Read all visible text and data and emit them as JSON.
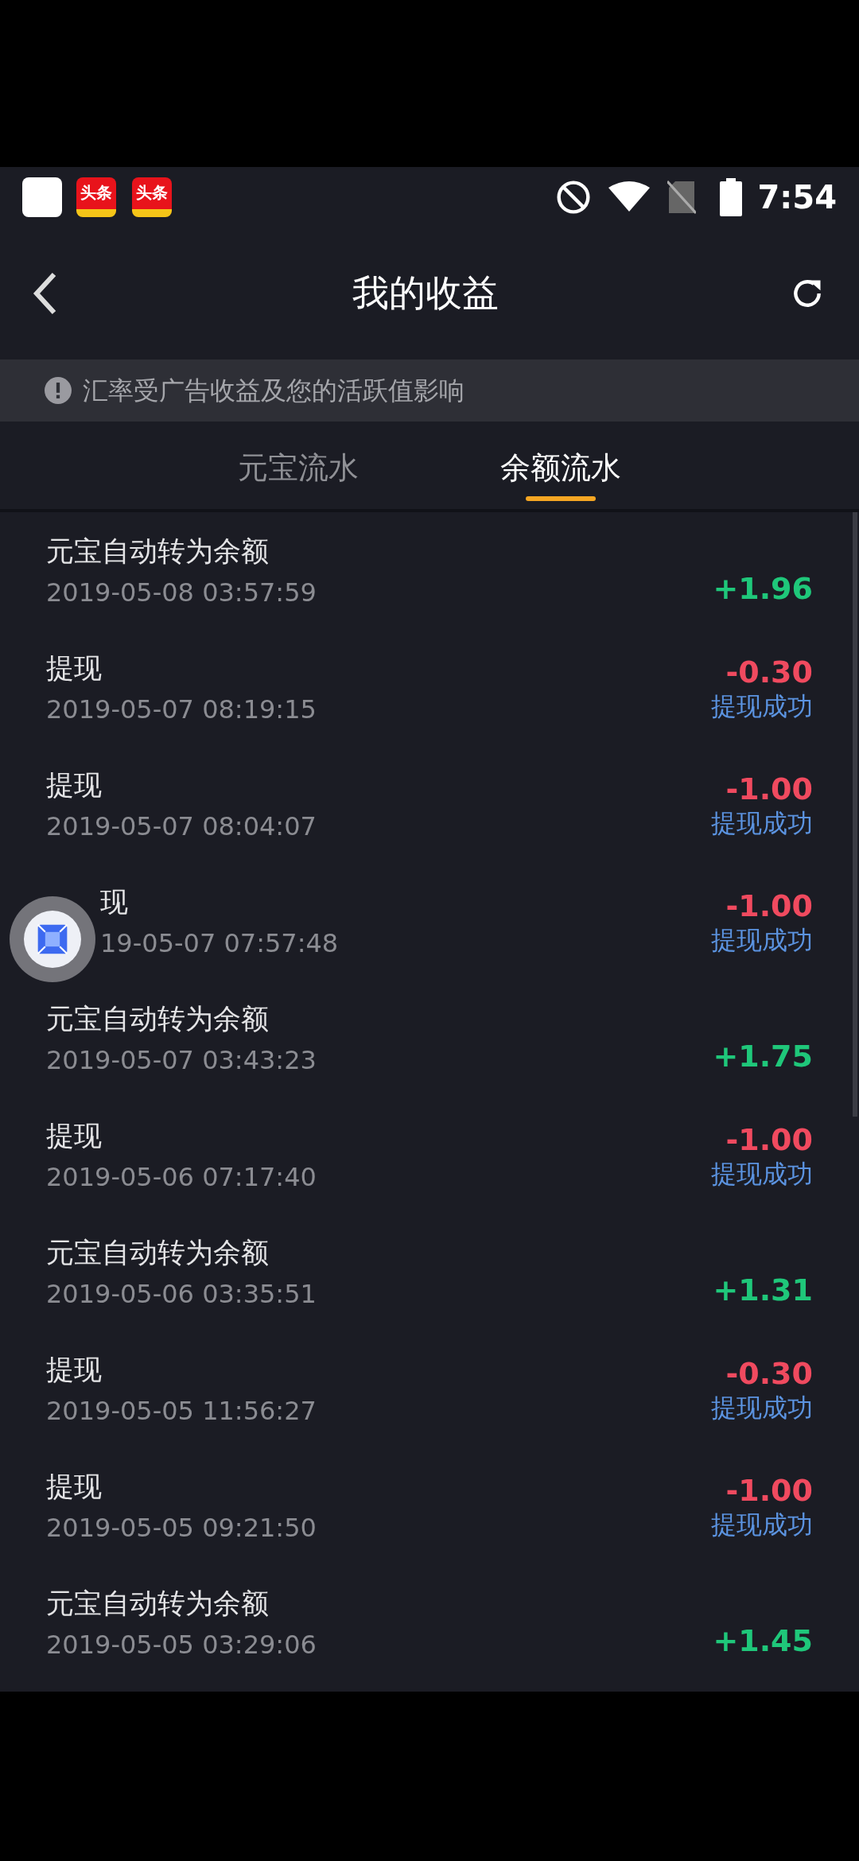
{
  "status_bar": {
    "apps": [
      "头条",
      "头条"
    ],
    "time": "7:54"
  },
  "header": {
    "title": "我的收益"
  },
  "notice": "汇率受广告收益及您的活跃值影响",
  "tabs": [
    {
      "label": "元宝流水",
      "selected": false
    },
    {
      "label": "余额流水",
      "selected": true
    }
  ],
  "records": [
    {
      "kind": "income",
      "title": "元宝自动转为余额",
      "time": "2019-05-08 03:57:59",
      "amount": "+1.96"
    },
    {
      "kind": "withdrawal",
      "title": "提现",
      "time": "2019-05-07 08:19:15",
      "amount": "-0.30",
      "status": "提现成功"
    },
    {
      "kind": "withdrawal",
      "title": "提现",
      "time": "2019-05-07 08:04:07",
      "amount": "-1.00",
      "status": "提现成功"
    },
    {
      "kind": "withdrawal",
      "title": "现",
      "time": "19-05-07 07:57:48",
      "amount": "-1.00",
      "status": "提现成功",
      "covered": true
    },
    {
      "kind": "income",
      "title": "元宝自动转为余额",
      "time": "2019-05-07 03:43:23",
      "amount": "+1.75"
    },
    {
      "kind": "withdrawal",
      "title": "提现",
      "time": "2019-05-06 07:17:40",
      "amount": "-1.00",
      "status": "提现成功"
    },
    {
      "kind": "income",
      "title": "元宝自动转为余额",
      "time": "2019-05-06 03:35:51",
      "amount": "+1.31"
    },
    {
      "kind": "withdrawal",
      "title": "提现",
      "time": "2019-05-05 11:56:27",
      "amount": "-0.30",
      "status": "提现成功"
    },
    {
      "kind": "withdrawal",
      "title": "提现",
      "time": "2019-05-05 09:21:50",
      "amount": "-1.00",
      "status": "提现成功"
    },
    {
      "kind": "income",
      "title": "元宝自动转为余额",
      "time": "2019-05-05 03:29:06",
      "amount": "+1.45"
    }
  ]
}
